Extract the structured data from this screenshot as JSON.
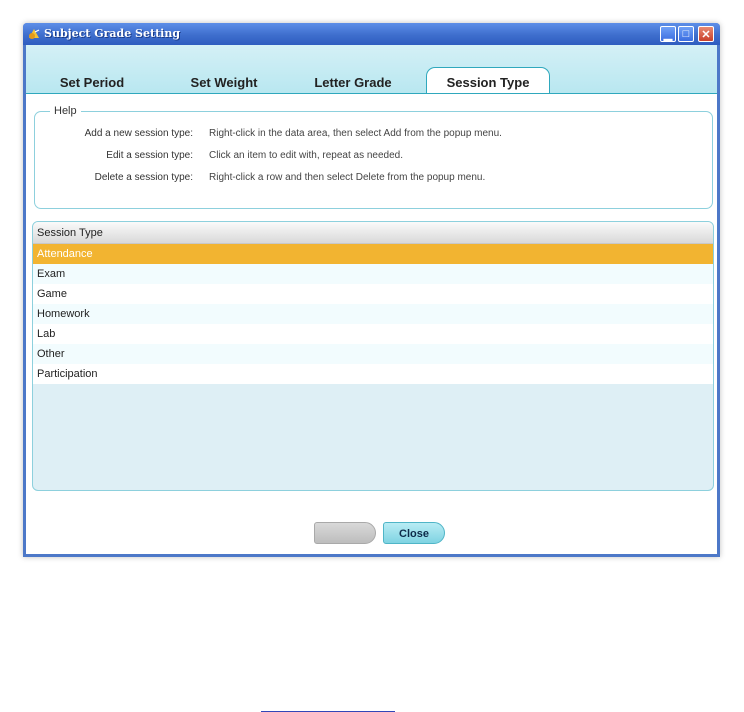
{
  "window": {
    "title": "Subject Grade Setting"
  },
  "tabs": [
    {
      "label": "Set Period"
    },
    {
      "label": "Set Weight"
    },
    {
      "label": "Letter Grade"
    },
    {
      "label": "Session Type",
      "active": true
    }
  ],
  "help": {
    "legend": "Help",
    "rows": [
      {
        "label": "Add a new session type:",
        "text": "Right-click in the data area, then select Add from the popup menu."
      },
      {
        "label": "Edit a session type:",
        "text": "Click an item to edit with, repeat as needed."
      },
      {
        "label": "Delete a session type:",
        "text": "Right-click a row and then select Delete from the popup menu."
      }
    ]
  },
  "grid": {
    "header": "Session Type",
    "rows": [
      "Attendance",
      "Exam",
      "Game",
      "Homework",
      "Lab",
      "Other",
      "Participation"
    ],
    "selected_index": 0
  },
  "buttons": {
    "disabled_label": "",
    "close_label": "Close"
  },
  "colors": {
    "titlebar": "#3e6ecd",
    "tab_border": "#2fa8bd",
    "selected_row": "#f2b431",
    "grid_bg": "#deeff5"
  },
  "icons": {
    "app": "app-logo-icon",
    "minimize": "minimize-icon",
    "maximize": "maximize-icon",
    "close": "close-icon"
  }
}
